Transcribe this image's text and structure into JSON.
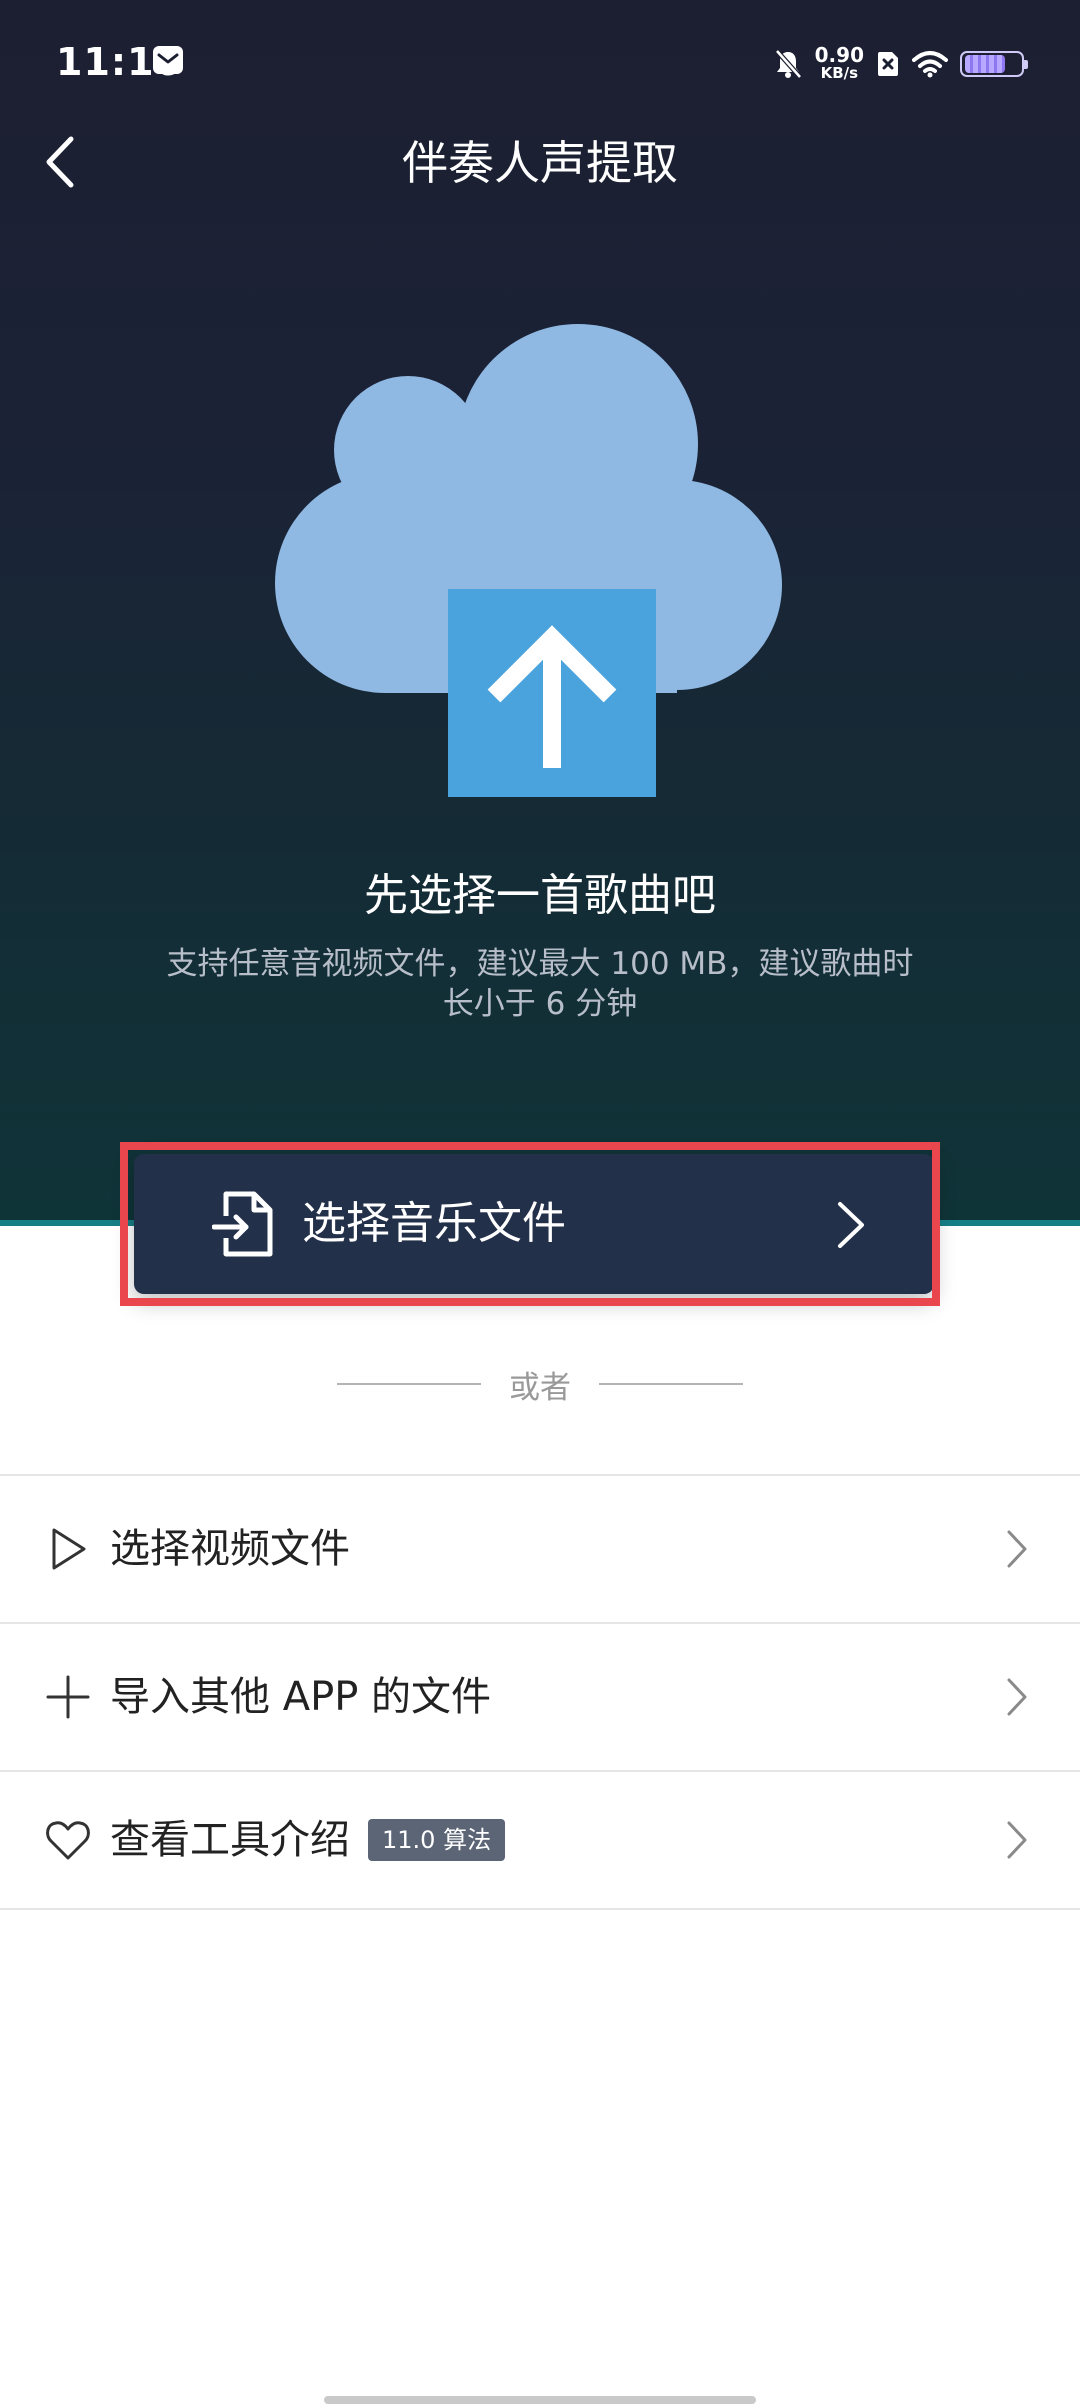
{
  "status_bar": {
    "time": "11:16",
    "net_speed_value": "0.90",
    "net_speed_unit": "KB/s"
  },
  "header": {
    "title": "伴奏人声提取"
  },
  "prompt": {
    "title": "先选择一首歌曲吧",
    "description": "支持任意音视频文件，建议最大 100 MB，建议歌曲时长小于 6 分钟"
  },
  "primary_action": {
    "label": "选择音乐文件"
  },
  "divider": {
    "text": "或者"
  },
  "list": {
    "items": [
      {
        "label": "选择视频文件",
        "icon": "play-icon"
      },
      {
        "label": "导入其他 APP 的文件",
        "icon": "plus-icon"
      },
      {
        "label": "查看工具介绍",
        "icon": "heart-icon",
        "badge": "11.0 算法"
      }
    ]
  },
  "colors": {
    "hero_top": "#1c1f31",
    "hero_bottom": "#0f3438",
    "cloud": "#8fb8e2",
    "upload_box": "#4aa3dc",
    "button_bg": "#233049",
    "highlight": "#e9474d",
    "badge_bg": "#5b6576"
  }
}
